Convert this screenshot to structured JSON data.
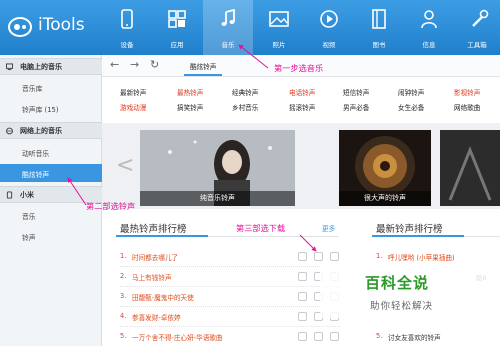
{
  "app": {
    "title": "iTools"
  },
  "nav": [
    {
      "label": "设备",
      "icon": "phone-icon"
    },
    {
      "label": "应用",
      "icon": "apps-icon"
    },
    {
      "label": "音乐",
      "icon": "music-icon",
      "active": true
    },
    {
      "label": "照片",
      "icon": "photo-icon"
    },
    {
      "label": "视频",
      "icon": "video-icon"
    },
    {
      "label": "图书",
      "icon": "book-icon"
    },
    {
      "label": "信息",
      "icon": "user-icon"
    },
    {
      "label": "工具箱",
      "icon": "tools-icon"
    }
  ],
  "sidebar": {
    "sections": [
      {
        "title": "电脑上的音乐",
        "items": [
          "音乐库",
          "铃声库 (15)"
        ]
      },
      {
        "title": "网络上的音乐",
        "items": [
          "动听音乐",
          "酷炫铃声"
        ]
      },
      {
        "title": "小米",
        "items": [
          "音乐",
          "铃声"
        ]
      }
    ],
    "selected": "酷炫铃声"
  },
  "toolbar": {
    "tab": "酷炫铃声"
  },
  "categories": {
    "row1": [
      "最新铃声",
      "最热铃声",
      "经典铃声",
      "电话铃声",
      "短信铃声",
      "闹钟铃声",
      "影视铃声"
    ],
    "row2": [
      "游戏动漫",
      "搞笑铃声",
      "乡村音乐",
      "摇滚铃声",
      "男声必备",
      "女生必备",
      "网络歌曲"
    ]
  },
  "banner": {
    "cards": [
      "纯音乐铃声",
      "很大声的铃声"
    ]
  },
  "hot_rank": {
    "title": "最热铃声排行榜",
    "more": "更多",
    "rows": [
      {
        "num": "1.",
        "name": "时间都去哪儿了"
      },
      {
        "num": "2.",
        "name": "马上有钱铃声"
      },
      {
        "num": "3.",
        "name": "田馥甄-魔鬼中的天使"
      },
      {
        "num": "4.",
        "name": "参喜发财-卓依婷"
      },
      {
        "num": "5.",
        "name": "一万个舍不得-庄心妍-华语歌曲"
      }
    ]
  },
  "new_rank": {
    "title": "最新铃声排行榜",
    "rows": [
      {
        "num": "1.",
        "name": "呼儿嘿哟 (小苹果插曲)"
      },
      {
        "num": "",
        "name": "酷8"
      },
      {
        "num": "5.",
        "name": "讨女友喜欢的铃声"
      }
    ]
  },
  "annotations": {
    "step1": "第一步选音乐",
    "step2": "第二部选铃声",
    "step3": "第三部选下载"
  },
  "watermark": {
    "title": "百科全说",
    "subtitle": "助你轻松解决"
  },
  "colors": {
    "accent": "#3a96e0",
    "topbar": "#2b8ad6",
    "annotation": "#e6109a",
    "category_red": "#e0341c",
    "category_black": "#222222"
  }
}
